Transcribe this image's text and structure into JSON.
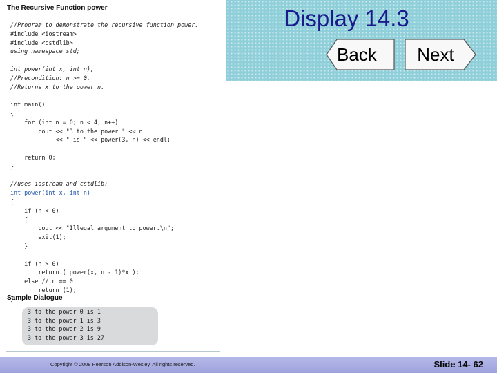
{
  "header": {
    "title": "Display 14.3",
    "back_label": "Back",
    "next_label": "Next",
    "band_color": "#8fcfd9"
  },
  "listing": {
    "title": "The Recursive Function power",
    "code_lines": [
      {
        "text": "//Program to demonstrate the recursive function power.",
        "style": "cmt"
      },
      {
        "text": "#include <iostream>",
        "style": ""
      },
      {
        "text": "#include <cstdlib>",
        "style": ""
      },
      {
        "text": "using namespace std;",
        "style": "cmt"
      },
      {
        "text": "",
        "style": ""
      },
      {
        "text": "int power(int x, int n);",
        "style": "cmt"
      },
      {
        "text": "//Precondition: n >= 0.",
        "style": "cmt"
      },
      {
        "text": "//Returns x to the power n.",
        "style": "cmt"
      },
      {
        "text": "",
        "style": ""
      },
      {
        "text": "int main()",
        "style": ""
      },
      {
        "text": "{",
        "style": ""
      },
      {
        "text": "    for (int n = 0; n < 4; n++)",
        "style": ""
      },
      {
        "text": "        cout << \"3 to the power \" << n",
        "style": ""
      },
      {
        "text": "             << \" is \" << power(3, n) << endl;",
        "style": ""
      },
      {
        "text": "",
        "style": ""
      },
      {
        "text": "    return 0;",
        "style": ""
      },
      {
        "text": "}",
        "style": ""
      },
      {
        "text": "",
        "style": ""
      },
      {
        "text": "//uses iostream and cstdlib:",
        "style": "cmt"
      },
      {
        "text": "int power(int x, int n)",
        "style": "blue"
      },
      {
        "text": "{",
        "style": ""
      },
      {
        "text": "    if (n < 0)",
        "style": ""
      },
      {
        "text": "    {",
        "style": ""
      },
      {
        "text": "        cout << \"Illegal argument to power.\\n\";",
        "style": ""
      },
      {
        "text": "        exit(1);",
        "style": ""
      },
      {
        "text": "    }",
        "style": ""
      },
      {
        "text": "",
        "style": ""
      },
      {
        "text": "    if (n > 0)",
        "style": ""
      },
      {
        "text": "        return ( power(x, n - 1)*x );",
        "style": ""
      },
      {
        "text": "    else // n == 0",
        "style": ""
      },
      {
        "text": "        return (1);",
        "style": ""
      },
      {
        "text": "}",
        "style": ""
      }
    ],
    "sample_label": "Sample Dialogue",
    "sample_lines": [
      "3 to the power 0 is 1",
      "3 to the power 1 is 3",
      "3 to the power 2 is 9",
      "3 to the power 3 is 27"
    ]
  },
  "footer": {
    "copyright": "Copyright © 2008 Pearson Addison-Wesley.  All rights reserved.",
    "slide_number": "Slide 14- 62"
  }
}
